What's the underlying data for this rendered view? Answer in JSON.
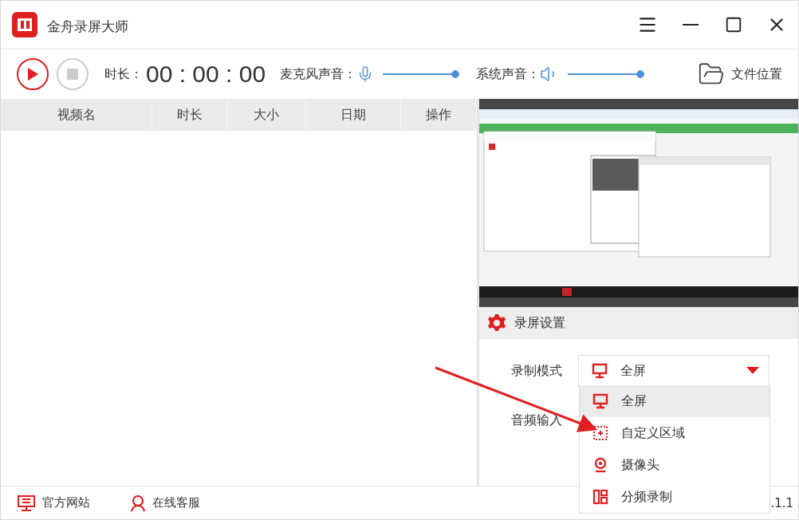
{
  "window": {
    "title": "金舟录屏大师"
  },
  "toolbar": {
    "duration_label": "时长：",
    "timer": "00 : 00 : 00",
    "mic": {
      "label": "麦克风声音：",
      "level": 1
    },
    "system": {
      "label": "系统声音：",
      "level": 1
    },
    "file_location": "文件位置"
  },
  "table": {
    "columns": [
      "视频名",
      "时长",
      "大小",
      "日期",
      "操作"
    ]
  },
  "settings": {
    "title": "录屏设置",
    "mode": {
      "label": "录制模式",
      "value": "全屏",
      "kind": "monitor",
      "expanded": true
    },
    "audio_label": "音频输入",
    "options": [
      {
        "label": "全屏",
        "kind": "monitor",
        "selected": true
      },
      {
        "label": "自定义区域",
        "kind": "region",
        "selected": false
      },
      {
        "label": "摄像头",
        "kind": "camera",
        "selected": false
      },
      {
        "label": "分频录制",
        "kind": "split",
        "selected": false
      }
    ]
  },
  "footer": {
    "links": [
      {
        "label": "官方网站",
        "kind": "website"
      },
      {
        "label": "在线客服",
        "kind": "support"
      }
    ],
    "version": ".1.1"
  }
}
